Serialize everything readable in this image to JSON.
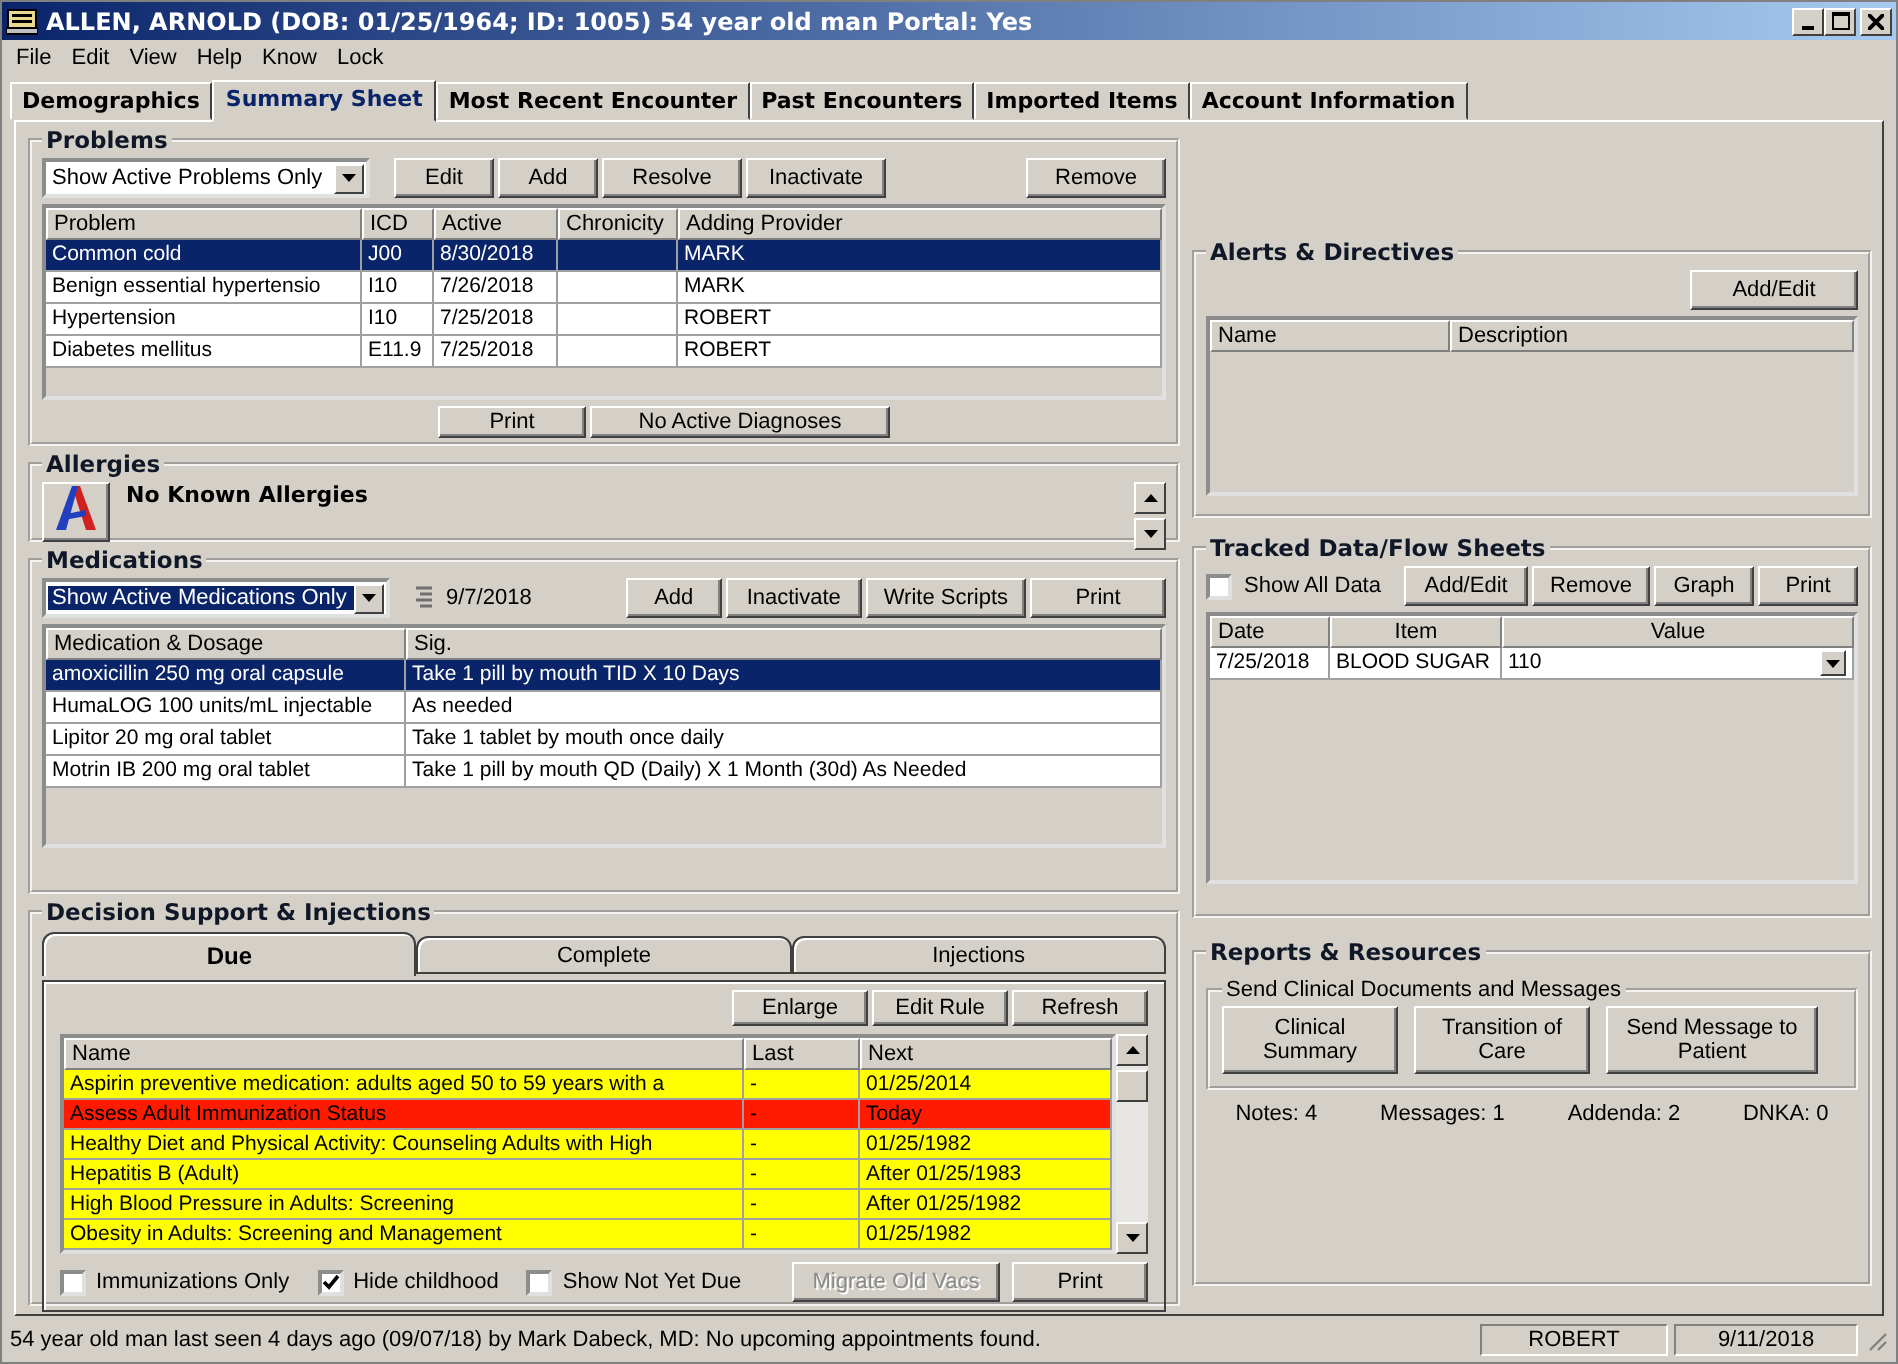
{
  "window": {
    "title": "ALLEN, ARNOLD (DOB: 01/25/1964; ID: 1005) 54 year old man  Portal: Yes"
  },
  "menu": [
    "File",
    "Edit",
    "View",
    "Help",
    "Know",
    "Lock"
  ],
  "tabs": [
    {
      "label": "Demographics",
      "selected": false
    },
    {
      "label": "Summary Sheet",
      "selected": true
    },
    {
      "label": "Most Recent Encounter",
      "selected": false
    },
    {
      "label": "Past Encounters",
      "selected": false
    },
    {
      "label": "Imported Items",
      "selected": false
    },
    {
      "label": "Account Information",
      "selected": false
    }
  ],
  "problems": {
    "title": "Problems",
    "filter": "Show Active Problems Only",
    "buttons": [
      "Edit",
      "Add",
      "Resolve",
      "Inactivate"
    ],
    "remove_button": "Remove",
    "columns": [
      "Problem",
      "ICD",
      "Active",
      "Chronicity",
      "Adding Provider"
    ],
    "rows": [
      {
        "cells": [
          "Common cold",
          "J00",
          "8/30/2018",
          "",
          "MARK"
        ],
        "selected": true
      },
      {
        "cells": [
          "Benign essential hypertensio",
          "I10",
          "7/26/2018",
          "",
          "MARK"
        ],
        "selected": false
      },
      {
        "cells": [
          "Hypertension",
          "I10",
          "7/25/2018",
          "",
          "ROBERT"
        ],
        "selected": false
      },
      {
        "cells": [
          "Diabetes mellitus",
          "E11.9",
          "7/25/2018",
          "",
          "ROBERT"
        ],
        "selected": false
      }
    ],
    "footer_buttons": [
      "Print",
      "No Active Diagnoses"
    ]
  },
  "allergies": {
    "title": "Allergies",
    "text": "No Known Allergies"
  },
  "medications": {
    "title": "Medications",
    "filter": "Show Active Medications Only",
    "date": "9/7/2018",
    "buttons": [
      "Add",
      "Inactivate",
      "Write Scripts",
      "Print"
    ],
    "columns": [
      "Medication & Dosage",
      "Sig."
    ],
    "rows": [
      {
        "cells": [
          "amoxicillin 250 mg oral capsule",
          "Take 1 pill by mouth TID X 10 Days"
        ],
        "selected": true
      },
      {
        "cells": [
          "HumaLOG 100 units/mL injectable",
          "As needed"
        ],
        "selected": false
      },
      {
        "cells": [
          "Lipitor 20 mg oral tablet",
          "Take 1 tablet by mouth once daily"
        ],
        "selected": false
      },
      {
        "cells": [
          "Motrin IB 200 mg oral tablet",
          "Take 1 pill by mouth QD (Daily) X 1 Month (30d) As Needed"
        ],
        "selected": false
      }
    ]
  },
  "decision_support": {
    "title": "Decision Support & Injections",
    "tabs": [
      {
        "label": "Due",
        "selected": true
      },
      {
        "label": "Complete",
        "selected": false
      },
      {
        "label": "Injections",
        "selected": false
      }
    ],
    "buttons": [
      "Enlarge",
      "Edit Rule",
      "Refresh"
    ],
    "columns": [
      "Name",
      "Last",
      "Next"
    ],
    "rows": [
      {
        "cells": [
          "Aspirin preventive medication: adults aged 50 to 59 years with a",
          "-",
          "01/25/2014"
        ],
        "color": "#ffff00"
      },
      {
        "cells": [
          "Assess Adult Immunization Status",
          "-",
          "Today"
        ],
        "color": "#ff1a00"
      },
      {
        "cells": [
          "Healthy Diet and Physical Activity: Counseling Adults with High",
          "-",
          "01/25/1982"
        ],
        "color": "#ffff00"
      },
      {
        "cells": [
          "Hepatitis B (Adult)",
          "-",
          "After 01/25/1983"
        ],
        "color": "#ffff00"
      },
      {
        "cells": [
          "High Blood Pressure in Adults: Screening",
          "-",
          "After 01/25/1982"
        ],
        "color": "#ffff00"
      },
      {
        "cells": [
          "Obesity in Adults: Screening and Management",
          "-",
          "01/25/1982"
        ],
        "color": "#ffff00"
      }
    ],
    "options": [
      {
        "label": "Immunizations Only",
        "checked": false
      },
      {
        "label": "Hide childhood",
        "checked": true
      },
      {
        "label": "Show Not Yet Due",
        "checked": false
      }
    ],
    "bottom_buttons": [
      {
        "label": "Migrate Old Vacs",
        "disabled": true
      },
      {
        "label": "Print",
        "disabled": false
      }
    ]
  },
  "alerts": {
    "title": "Alerts & Directives",
    "button": "Add/Edit",
    "columns": [
      "Name",
      "Description"
    ]
  },
  "tracked": {
    "title": "Tracked Data/Flow Sheets",
    "show_all": {
      "label": "Show All Data",
      "checked": false
    },
    "buttons": [
      "Add/Edit",
      "Remove",
      "Graph",
      "Print"
    ],
    "columns": [
      "Date",
      "Item",
      "Value"
    ],
    "rows": [
      {
        "cells": [
          "7/25/2018",
          "BLOOD SUGAR",
          "110"
        ]
      }
    ]
  },
  "reports": {
    "title": "Reports & Resources",
    "group_title": "Send Clinical Documents and Messages",
    "buttons": [
      "Clinical Summary",
      "Transition of Care",
      "Send Message to Patient"
    ],
    "counts": [
      "Notes: 4",
      "Messages: 1",
      "Addenda: 2",
      "DNKA: 0"
    ]
  },
  "status_bar": {
    "message": "54 year old man last seen 4 days ago (09/07/18) by Mark Dabeck, MD: No upcoming appointments found.",
    "user": "ROBERT",
    "date": "9/11/2018"
  }
}
